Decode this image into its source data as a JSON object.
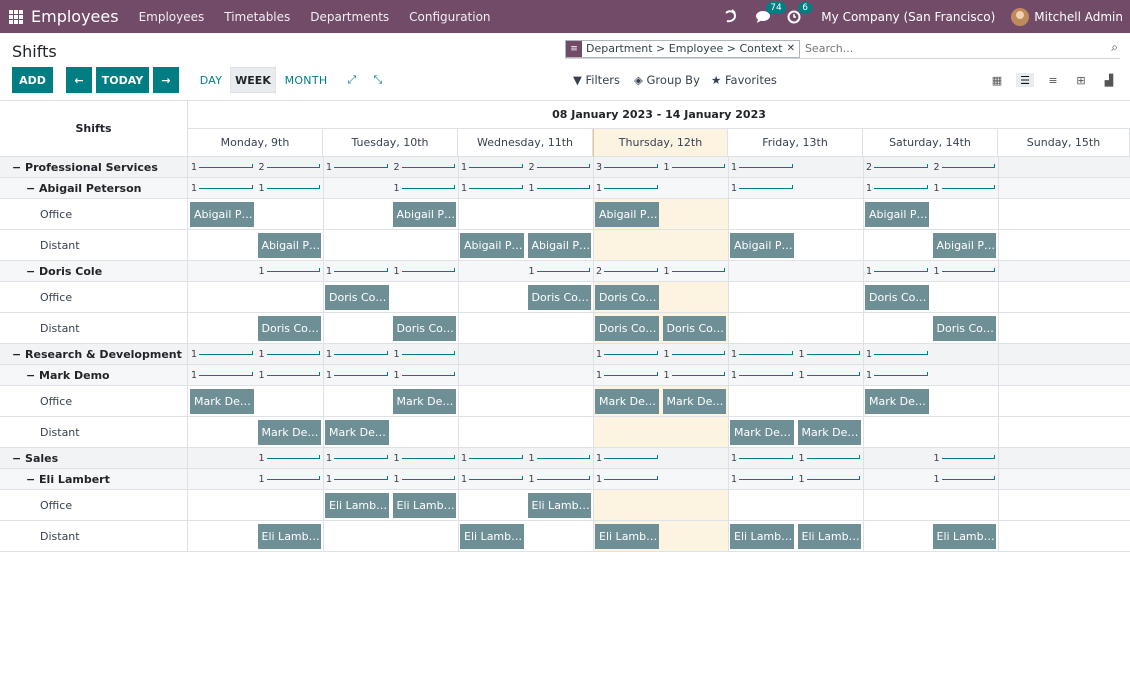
{
  "navbar": {
    "app": "Employees",
    "menus": [
      "Employees",
      "Timetables",
      "Departments",
      "Configuration"
    ],
    "msg_count": "74",
    "activity_count": "6",
    "company": "My Company (San Francisco)",
    "user": "Mitchell Admin"
  },
  "cp": {
    "title": "Shifts",
    "facet": "Department > Employee > Context",
    "search_placeholder": "Search...",
    "add": "ADD",
    "today": "TODAY",
    "scales": [
      "DAY",
      "WEEK",
      "MONTH"
    ],
    "filters": "Filters",
    "groupby": "Group By",
    "favorites": "Favorites"
  },
  "gantt": {
    "range": "08 January 2023 - 14 January 2023",
    "rows_header": "Shifts",
    "days": [
      "Monday, 9th",
      "Tuesday, 10th",
      "Wednesday, 11th",
      "Thursday, 12th",
      "Friday, 13th",
      "Saturday, 14th",
      "Sunday, 15th"
    ],
    "today_index": 3,
    "rows": [
      {
        "kind": "g",
        "label": "Professional Services",
        "counts": [
          [
            0,
            0,
            "1"
          ],
          [
            1,
            1,
            "2"
          ],
          [
            2,
            2,
            "1"
          ],
          [
            3,
            3,
            "2"
          ],
          [
            4,
            4,
            "1"
          ],
          [
            5,
            5,
            "2"
          ],
          [
            6,
            6,
            "3"
          ],
          [
            7,
            7,
            "1"
          ],
          [
            8,
            8,
            "1"
          ],
          [
            10,
            10,
            "2"
          ],
          [
            11,
            11,
            "2"
          ]
        ]
      },
      {
        "kind": "sg",
        "label": "Abigail Peterson",
        "counts": [
          [
            0,
            0,
            "1"
          ],
          [
            1,
            1,
            "1"
          ],
          [
            3,
            3,
            "1"
          ],
          [
            4,
            4,
            "1"
          ],
          [
            5,
            5,
            "1"
          ],
          [
            6,
            6,
            "1"
          ],
          [
            8,
            8,
            "1"
          ],
          [
            10,
            10,
            "1"
          ],
          [
            11,
            11,
            "1"
          ]
        ]
      },
      {
        "kind": "r",
        "label": "Office",
        "pills": [
          [
            0,
            "Abigail P…"
          ],
          [
            3,
            "Abigail P…"
          ],
          [
            6,
            "Abigail P…"
          ],
          [
            10,
            "Abigail P…"
          ]
        ]
      },
      {
        "kind": "r",
        "label": "Distant",
        "pills": [
          [
            1,
            "Abigail P…"
          ],
          [
            4,
            "Abigail P…"
          ],
          [
            5,
            "Abigail P…"
          ],
          [
            8,
            "Abigail P…"
          ],
          [
            11,
            "Abigail P…"
          ]
        ]
      },
      {
        "kind": "sg",
        "label": "Doris Cole",
        "counts": [
          [
            1,
            1,
            "1"
          ],
          [
            2,
            2,
            "1"
          ],
          [
            3,
            3,
            "1"
          ],
          [
            5,
            5,
            "1"
          ],
          [
            6,
            6,
            "2"
          ],
          [
            7,
            7,
            "1"
          ],
          [
            10,
            10,
            "1"
          ],
          [
            11,
            11,
            "1"
          ]
        ]
      },
      {
        "kind": "r",
        "label": "Office",
        "pills": [
          [
            2,
            "Doris Co…"
          ],
          [
            5,
            "Doris Co…"
          ],
          [
            6,
            "Doris Co…"
          ],
          [
            10,
            "Doris Co…"
          ]
        ]
      },
      {
        "kind": "r",
        "label": "Distant",
        "pills": [
          [
            1,
            "Doris Co…"
          ],
          [
            3,
            "Doris Co…"
          ],
          [
            6,
            "Doris Co…"
          ],
          [
            7,
            "Doris Co…"
          ],
          [
            11,
            "Doris Co…"
          ]
        ]
      },
      {
        "kind": "g",
        "label": "Research & Development",
        "counts": [
          [
            0,
            0,
            "1"
          ],
          [
            1,
            1,
            "1"
          ],
          [
            2,
            2,
            "1"
          ],
          [
            3,
            3,
            "1"
          ],
          [
            6,
            6,
            "1"
          ],
          [
            7,
            7,
            "1"
          ],
          [
            8,
            8,
            "1"
          ],
          [
            9,
            9,
            "1"
          ],
          [
            10,
            10,
            "1"
          ]
        ]
      },
      {
        "kind": "sg",
        "label": "Mark Demo",
        "counts": [
          [
            0,
            0,
            "1"
          ],
          [
            1,
            1,
            "1"
          ],
          [
            2,
            2,
            "1"
          ],
          [
            3,
            3,
            "1"
          ],
          [
            6,
            6,
            "1"
          ],
          [
            7,
            7,
            "1"
          ],
          [
            8,
            8,
            "1"
          ],
          [
            9,
            9,
            "1"
          ],
          [
            10,
            10,
            "1"
          ]
        ]
      },
      {
        "kind": "r",
        "label": "Office",
        "pills": [
          [
            0,
            "Mark De…"
          ],
          [
            3,
            "Mark De…"
          ],
          [
            6,
            "Mark De…"
          ],
          [
            7,
            "Mark De…"
          ],
          [
            10,
            "Mark De…"
          ]
        ]
      },
      {
        "kind": "r",
        "label": "Distant",
        "pills": [
          [
            1,
            "Mark De…"
          ],
          [
            2,
            "Mark De…"
          ],
          [
            8,
            "Mark De…"
          ],
          [
            9,
            "Mark De…"
          ]
        ]
      },
      {
        "kind": "g",
        "label": "Sales",
        "counts": [
          [
            1,
            1,
            "1"
          ],
          [
            2,
            2,
            "1"
          ],
          [
            3,
            3,
            "1"
          ],
          [
            4,
            4,
            "1"
          ],
          [
            5,
            5,
            "1"
          ],
          [
            6,
            6,
            "1"
          ],
          [
            8,
            8,
            "1"
          ],
          [
            9,
            9,
            "1"
          ],
          [
            11,
            11,
            "1"
          ]
        ]
      },
      {
        "kind": "sg",
        "label": "Eli Lambert",
        "counts": [
          [
            1,
            1,
            "1"
          ],
          [
            2,
            2,
            "1"
          ],
          [
            3,
            3,
            "1"
          ],
          [
            4,
            4,
            "1"
          ],
          [
            5,
            5,
            "1"
          ],
          [
            6,
            6,
            "1"
          ],
          [
            8,
            8,
            "1"
          ],
          [
            9,
            9,
            "1"
          ],
          [
            11,
            11,
            "1"
          ]
        ]
      },
      {
        "kind": "r",
        "label": "Office",
        "pills": [
          [
            2,
            "Eli Lamb…"
          ],
          [
            3,
            "Eli Lamb…"
          ],
          [
            5,
            "Eli Lamb…"
          ]
        ]
      },
      {
        "kind": "r",
        "label": "Distant",
        "pills": [
          [
            1,
            "Eli Lamb…"
          ],
          [
            4,
            "Eli Lamb…"
          ],
          [
            6,
            "Eli Lamb…"
          ],
          [
            8,
            "Eli Lamb…"
          ],
          [
            9,
            "Eli Lamb…"
          ],
          [
            11,
            "Eli Lamb…"
          ]
        ]
      }
    ]
  }
}
